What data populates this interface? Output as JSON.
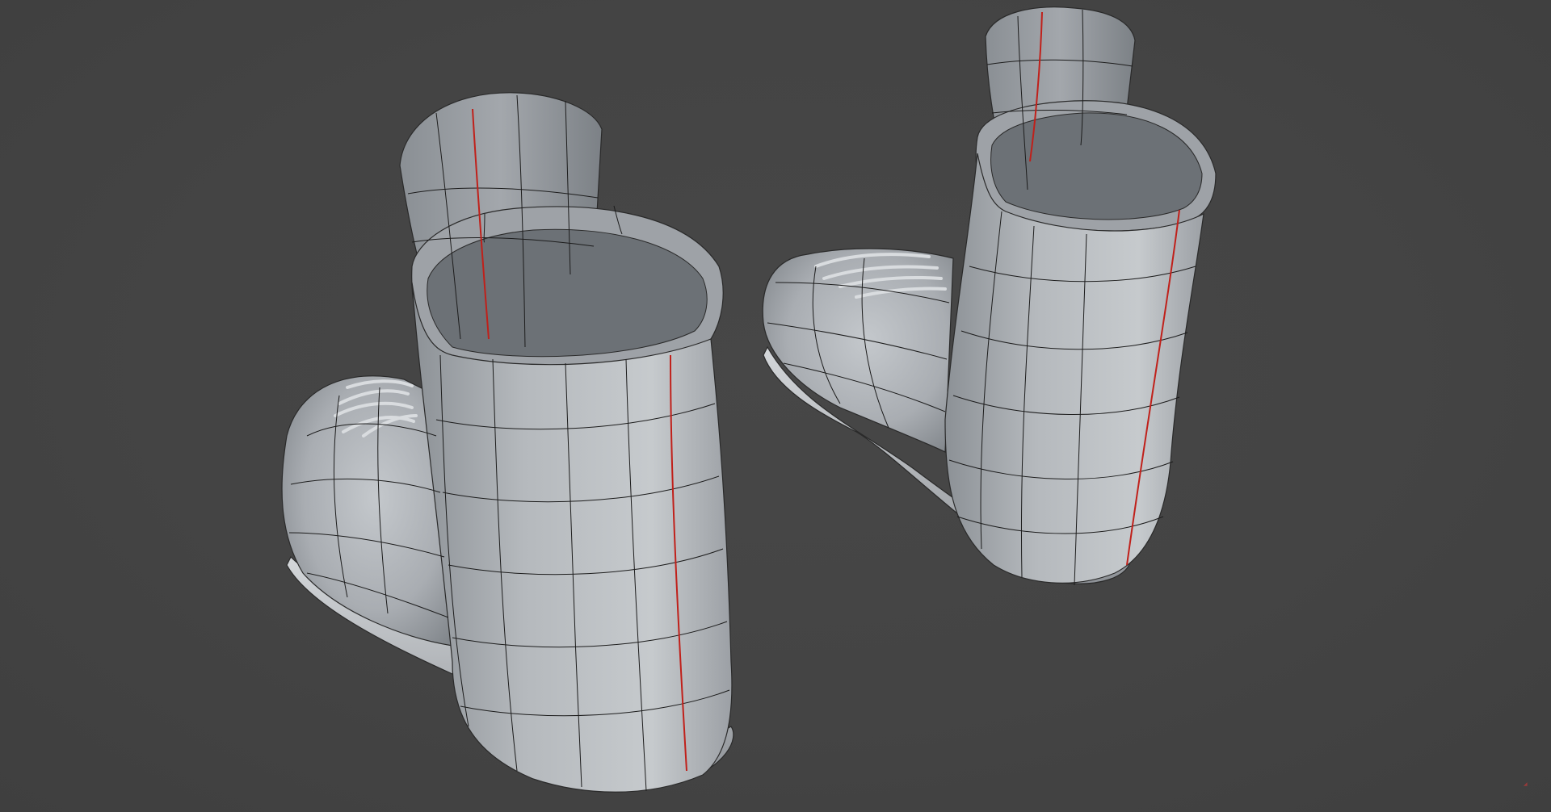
{
  "viewport": {
    "background_color": "#444444",
    "mesh_color": "#b7bbbf",
    "edge_color": "#1a1a1a",
    "seam_color": "#c0201a"
  },
  "scene": {
    "objects": [
      {
        "name": "boot-left",
        "shading": "smooth",
        "wireframe_overlay": true,
        "uv_seam_visible": true
      },
      {
        "name": "boot-right",
        "shading": "smooth",
        "wireframe_overlay": true,
        "uv_seam_visible": true
      }
    ]
  },
  "corner_marker": {
    "icon": "axis-gizmo-icon"
  }
}
